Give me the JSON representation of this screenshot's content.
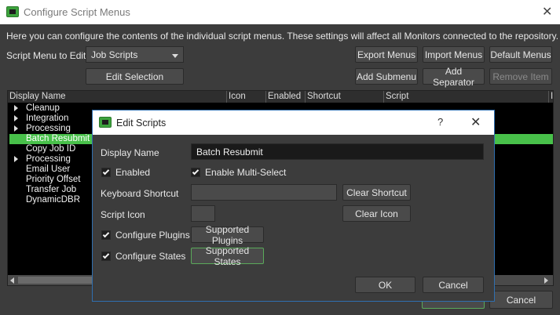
{
  "window": {
    "title": "Configure Script Menus",
    "close_glyph": "✕"
  },
  "description": "Here you can configure the contents of the individual script menus. These settings will affect all Monitors connected to the repository.",
  "menu_select": {
    "label": "Script Menu to Edit:",
    "value": "Job Scripts"
  },
  "buttons": {
    "export": "Export Menus",
    "import": "Import Menus",
    "default": "Default Menus",
    "edit_selection": "Edit Selection",
    "add_submenu": "Add Submenu",
    "add_separator": "Add Separator",
    "remove_item": "Remove Item",
    "cancel": "Cancel"
  },
  "columns": [
    "Display Name",
    "Icon",
    "Enabled",
    "Shortcut",
    "Script",
    "I"
  ],
  "tree_items": [
    {
      "label": "Cleanup",
      "expandable": true,
      "selected": false
    },
    {
      "label": "Integration",
      "expandable": true,
      "selected": false
    },
    {
      "label": "Processing",
      "expandable": true,
      "selected": false
    },
    {
      "label": "Batch Resubmit",
      "expandable": false,
      "selected": true
    },
    {
      "label": "Copy Job ID",
      "expandable": false,
      "selected": false
    },
    {
      "label": "Processing",
      "expandable": true,
      "selected": false
    },
    {
      "label": "Email User",
      "expandable": false,
      "selected": false
    },
    {
      "label": "Priority Offset",
      "expandable": false,
      "selected": false
    },
    {
      "label": "Transfer Job",
      "expandable": false,
      "selected": false
    },
    {
      "label": "DynamicDBR",
      "expandable": false,
      "selected": false
    }
  ],
  "dialog": {
    "title": "Edit Scripts",
    "help_glyph": "?",
    "close_glyph": "✕",
    "display_name_label": "Display Name",
    "display_name_value": "Batch Resubmit",
    "enabled_label": "Enabled",
    "multi_select_label": "Enable Multi-Select",
    "shortcut_label": "Keyboard Shortcut",
    "clear_shortcut": "Clear Shortcut",
    "icon_label": "Script Icon",
    "clear_icon": "Clear Icon",
    "plugins_label": "Configure Plugins",
    "plugins_button": "Supported Plugins",
    "states_label": "Configure States",
    "states_button": "Supported States",
    "ok": "OK",
    "cancel": "Cancel"
  },
  "colors": {
    "accent": "#48c04a",
    "dialog_border": "#2f6fb0",
    "background": "#3c3c3c"
  }
}
